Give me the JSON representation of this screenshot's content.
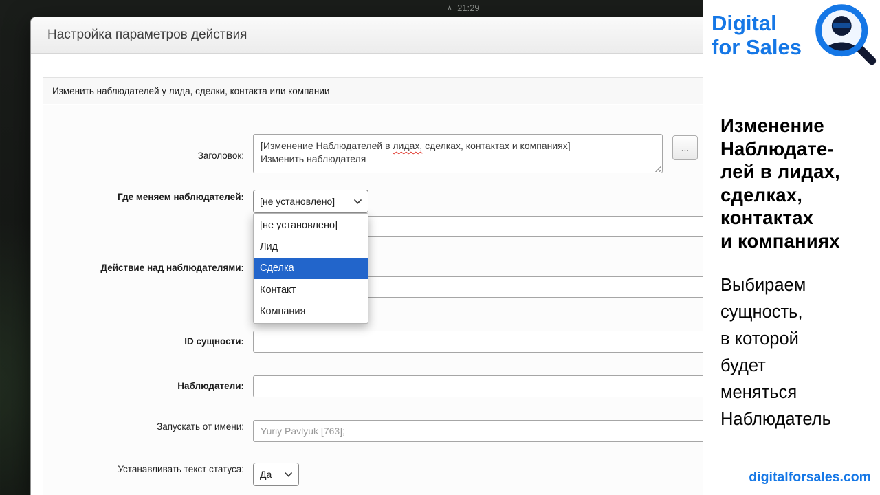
{
  "taskbar": {
    "caret": "∧",
    "clock": "21:29"
  },
  "dialog": {
    "title": "Настройка параметров действия",
    "action_bar": "Изменить наблюдателей у лида, сделки, контакта или компании",
    "form": {
      "title": {
        "label": "Заголовок:",
        "line1_pre": "[Изменение Наблюдателей в ",
        "line1_misspelled": "лидах,",
        "line1_post": " сделках, контактах и компаниях]",
        "line2": "Изменить наблюдателя",
        "more_button": "..."
      },
      "entity": {
        "label": "Где меняем наблюдателей:",
        "value": "[не установлено]",
        "dropdown_options": [
          "[не установлено]",
          "Лид",
          "Сделка",
          "Контакт",
          "Компания"
        ],
        "highlighted_option": "Сделка"
      },
      "action": {
        "label": "Действие над наблюдателями:"
      },
      "entity_id": {
        "label": "ID сущности:",
        "value": ""
      },
      "observers": {
        "label": "Наблюдатели:",
        "value": ""
      },
      "run_as": {
        "label": "Запускать от имени:",
        "value": "Yuriy Pavlyuk [763];"
      },
      "status_text": {
        "label": "Устанавливать текст статуса:",
        "value": "Да"
      }
    }
  },
  "sidebar": {
    "brand": "Digital\nfor Sales",
    "heading": "Изменение\nНаблюдате-\nлей в лидах,\nсделках,\nконтактах\nи компаниях",
    "note": "Выбираем\nсущность,\nв которой\nбудет\nменяться\nНаблюдатель",
    "website": "digitalforsales.com",
    "colors": {
      "brand_blue": "#1577e6",
      "dropdown_highlight": "#2265cb"
    }
  }
}
